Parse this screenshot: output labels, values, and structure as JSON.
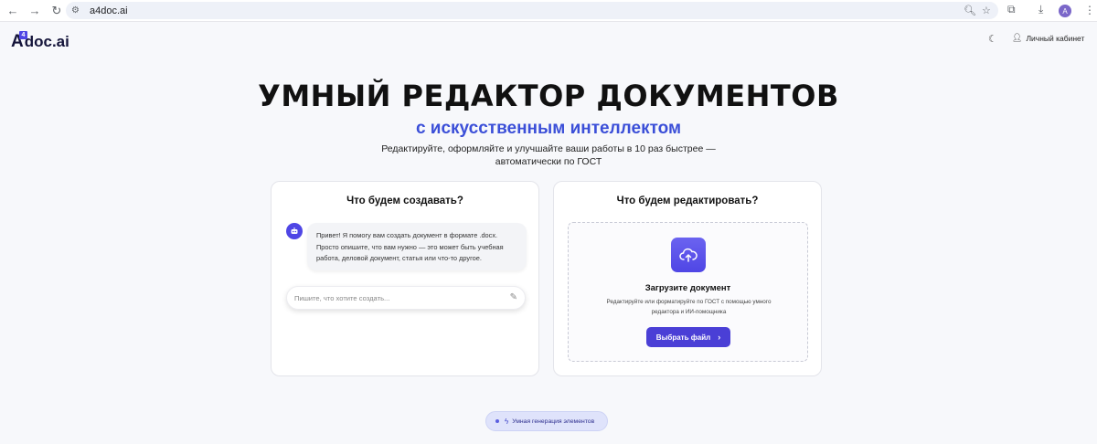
{
  "browser": {
    "url": "a4doc.ai",
    "profile_initial": "A"
  },
  "header": {
    "logo_mark": "A",
    "logo_badge": "4",
    "logo_text": "doc.ai",
    "account_label": "Личный кабинет"
  },
  "hero": {
    "title": "УМНЫЙ РЕДАКТОР ДОКУМЕНТОВ",
    "subtitle": "с искусственным интеллектом",
    "description": "Редактируйте, оформляйте и улучшайте ваши работы в 10 раз быстрее — автоматически по ГОСТ"
  },
  "create_card": {
    "title": "Что будем создавать?",
    "bot_message": "Привет! Я помогу вам создать документ в формате .docx. Просто опишите, что вам нужно — это может быть учебная работа, деловой документ, статья или что-то другое.",
    "input_placeholder": "Пишите, что хотите создать..."
  },
  "edit_card": {
    "title": "Что будем редактировать?",
    "upload_title": "Загрузите документ",
    "upload_description": "Редактируйте или форматируйте по ГОСТ с помощью умного редактора и ИИ-помощника",
    "button_label": "Выбрать файл"
  },
  "bottom_pill": {
    "label": "Умная генерация элементов"
  },
  "colors": {
    "accent": "#4f46e5",
    "subtitle_blue": "#3b4fd8",
    "button": "#4a3fd6"
  }
}
